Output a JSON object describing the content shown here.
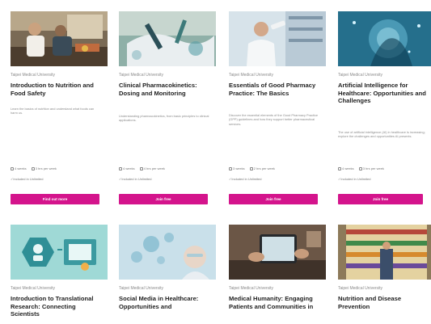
{
  "courses": [
    {
      "provider": "Taipei Medical University",
      "title": "Introduction to Nutrition and Food Safety",
      "description": "Learn the basics of nutrition and understand what foods can harm us.",
      "duration": "4 weeks",
      "effort": "3 hrs per week",
      "access": "Included in Unlimited",
      "button": "Find out more",
      "image_icon": "kitchen-photo"
    },
    {
      "provider": "Taipei Medical University",
      "title": "Clinical Pharmacokinetics: Dosing and Monitoring",
      "description": "Understanding pharmacokinetics, from basic principles to clinical applications.",
      "duration": "4 weeks",
      "effort": "4 hrs per week",
      "access": "Included in Unlimited",
      "button": "Join free",
      "image_icon": "lab-glove-photo"
    },
    {
      "provider": "Taipei Medical University",
      "title": "Essentials of Good Pharmacy Practice: The Basics",
      "description": "Discover the essential elements of the Good Pharmacy Practice (GPP) guidelines and how they support better pharmaceutical services.",
      "duration": "3 weeks",
      "effort": "2 hrs per week",
      "access": "Included in Unlimited",
      "button": "Join free",
      "image_icon": "pharmacist-photo"
    },
    {
      "provider": "Taipei Medical University",
      "title": "Artificial Intelligence for Healthcare: Opportunities and Challenges",
      "description": "The use of artificial intelligence (AI) in healthcare is increasing; explore the challenges and opportunities AI presents.",
      "duration": "4 weeks",
      "effort": "3 hrs per week",
      "access": "Included in Unlimited",
      "button": "Join free",
      "image_icon": "ai-head-photo"
    },
    {
      "provider": "Taipei Medical University",
      "title": "Introduction to Translational Research: Connecting Scientists",
      "image_icon": "research-illustration"
    },
    {
      "provider": "Taipei Medical University",
      "title": "Social Media in Healthcare: Opportunities and",
      "image_icon": "social-media-photo"
    },
    {
      "provider": "Taipei Medical University",
      "title": "Medical Humanity: Engaging Patients and Communities in",
      "image_icon": "tablet-photo"
    },
    {
      "provider": "Taipei Medical University",
      "title": "Nutrition and Disease Prevention",
      "image_icon": "grocery-photo"
    }
  ],
  "colors": {
    "button": "#d4148c"
  }
}
